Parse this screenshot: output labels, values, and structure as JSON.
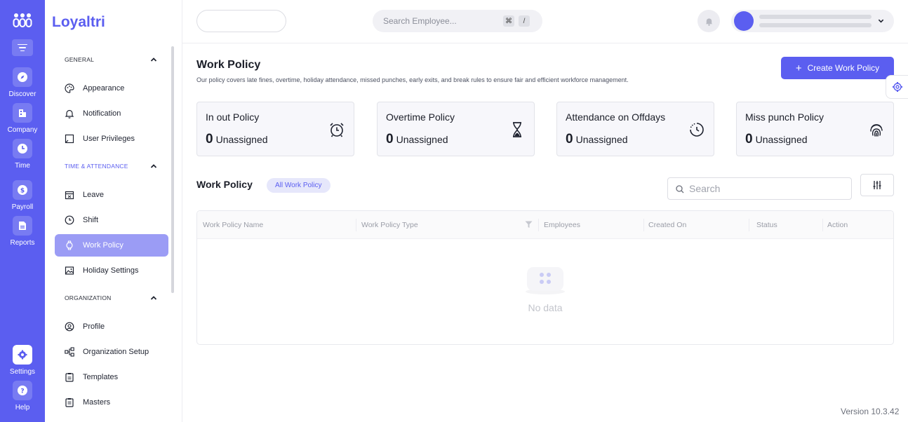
{
  "app": {
    "name": "Loyaltri"
  },
  "rail": {
    "items": [
      {
        "label": "Discover",
        "icon": "compass-icon"
      },
      {
        "label": "Company",
        "icon": "building-icon"
      },
      {
        "label": "Time",
        "icon": "clock-icon"
      },
      {
        "label": "Payroll",
        "icon": "dollar-icon"
      },
      {
        "label": "Reports",
        "icon": "document-icon"
      }
    ],
    "bottom": [
      {
        "label": "Settings",
        "icon": "gear-icon",
        "active": true
      },
      {
        "label": "Help",
        "icon": "help-icon"
      }
    ]
  },
  "sidebar": {
    "sections": [
      {
        "title": "GENERAL",
        "items": [
          "Appearance",
          "Notification",
          "User Privileges"
        ]
      },
      {
        "title": "TIME & ATTENDANCE",
        "items": [
          "Leave",
          "Shift",
          "Work Policy",
          "Holiday Settings"
        ]
      },
      {
        "title": "ORGANIZATION",
        "items": [
          "Profile",
          "Organization Setup",
          "Templates",
          "Masters"
        ]
      }
    ],
    "active_item": "Work Policy"
  },
  "topbar": {
    "search_placeholder": "Search Employee...",
    "shortcut_keys": [
      "⌘",
      "/"
    ]
  },
  "page": {
    "title": "Work Policy",
    "subtitle": "Our policy covers late fines, overtime, holiday attendance, missed punches, early exits, and break rules to ensure fair and efficient workforce management.",
    "create_button": "Create Work Policy"
  },
  "cards": [
    {
      "title": "In out Policy",
      "count": "0",
      "status": "Unassigned",
      "icon": "alarm-clock-icon"
    },
    {
      "title": "Overtime Policy",
      "count": "0",
      "status": "Unassigned",
      "icon": "hourglass-icon"
    },
    {
      "title": "Attendance on Offdays",
      "count": "0",
      "status": "Unassigned",
      "icon": "clock-dashed-icon"
    },
    {
      "title": "Miss punch Policy",
      "count": "0",
      "status": "Unassigned",
      "icon": "fingerprint-icon"
    }
  ],
  "list": {
    "title": "Work Policy",
    "tag": "All Work Policy",
    "search_placeholder": "Search",
    "columns": [
      "Work Policy Name",
      "Work Policy Type",
      "Employees",
      "Created On",
      "Status",
      "Action"
    ],
    "rows": [],
    "empty_text": "No data"
  },
  "footer": {
    "version": "Version 10.3.42"
  },
  "colors": {
    "accent": "#5b5ef0",
    "active_nav": "#9b9cf5"
  }
}
